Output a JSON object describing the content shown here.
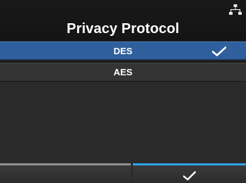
{
  "header": {
    "title": "Privacy Protocol",
    "status_icon": "network-icon"
  },
  "options": [
    {
      "label": "DES",
      "selected": true,
      "icon": "checkmark-icon"
    },
    {
      "label": "AES",
      "selected": false
    }
  ],
  "softkeys": {
    "left": {
      "label": ""
    },
    "right": {
      "icon": "checkmark-icon",
      "accent": "#2da2e8"
    }
  },
  "colors": {
    "selected_row": "#2f5f9c",
    "background": "#252525",
    "confirm_accent": "#2da2e8",
    "neutral_accent": "#8f8f8f"
  }
}
